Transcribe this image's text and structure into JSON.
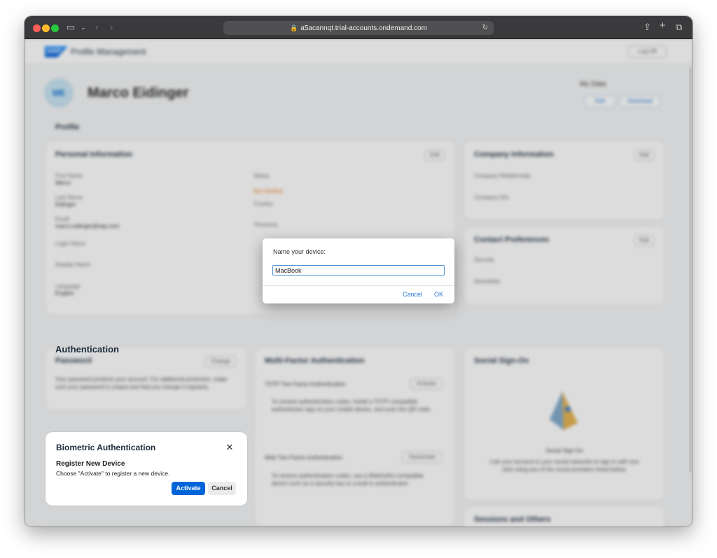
{
  "browser": {
    "url": "a5acannqt.trial-accounts.ondemand.com"
  },
  "shellbar": {
    "logo": "SAP",
    "title": "Profile Management",
    "logout_label": "Log Off"
  },
  "header": {
    "avatar_initials": "ME",
    "user_name": "Marco Eidinger",
    "my_data_label": "My Data",
    "my_data_buttons": [
      "Edit",
      "Download"
    ]
  },
  "profile": {
    "section_title": "Profile",
    "personal": {
      "title": "Personal Information",
      "edit_label": "Edit",
      "fields": [
        {
          "label": "First Name",
          "value": "Marco"
        },
        {
          "label": "Last Name",
          "value": "Eidinger"
        },
        {
          "label": "Email",
          "value": "marco.eidinger@sap.com"
        },
        {
          "label": "Login Name",
          "value": ""
        },
        {
          "label": "Display Name",
          "value": ""
        },
        {
          "label": "Language",
          "value": "English"
        }
      ],
      "right_fields": [
        {
          "label": "Status",
          "value": "Not Verified"
        },
        {
          "label": "Country",
          "value": ""
        },
        {
          "label": "Timezone",
          "value": ""
        }
      ]
    },
    "company": {
      "title": "Company Information",
      "edit_label": "Edit",
      "fields": [
        "Company Relationship",
        "Company Info"
      ]
    },
    "contact": {
      "title": "Contact Preferences",
      "edit_label": "Edit",
      "fields": [
        "Security",
        "Newsletter"
      ]
    }
  },
  "authentication": {
    "section_title": "Authentication",
    "password": {
      "title": "Password",
      "change_label": "Change",
      "description": "Your password protects your account. For additional protection, make sure your password is unique and that you change it regularly."
    },
    "mfa": {
      "title": "Multi-Factor Authentication",
      "totp_title": "TOTP Two-Factor Authentication",
      "totp_action": "Activate",
      "totp_text": "To receive authentication codes, install a TOTP-compatible authenticator app on your mobile device, and scan the QR code.",
      "webauthn_title": "Web Two-Factor Authentication",
      "webauthn_action": "Deactivate",
      "webauthn_text": "To receive authentication codes, use a WebAuthn-compatible device such as a security key or a built-in authenticator."
    },
    "sso": {
      "title": "Social Sign-On",
      "subtitle": "Social Sign-On",
      "text": "Link your account to your social networks to sign in with one click using any of the social providers listed below."
    },
    "sessions": {
      "title": "Sessions and Others"
    },
    "biometric": {
      "title": "Biometric Authentication",
      "close_glyph": "✕",
      "subtitle": "Register New Device",
      "description": "Choose \"Activate\" to register a new device.",
      "activate_label": "Activate",
      "cancel_label": "Cancel"
    }
  },
  "dialog": {
    "prompt": "Name your device:",
    "input_value": "MacBook",
    "cancel_label": "Cancel",
    "ok_label": "OK"
  }
}
